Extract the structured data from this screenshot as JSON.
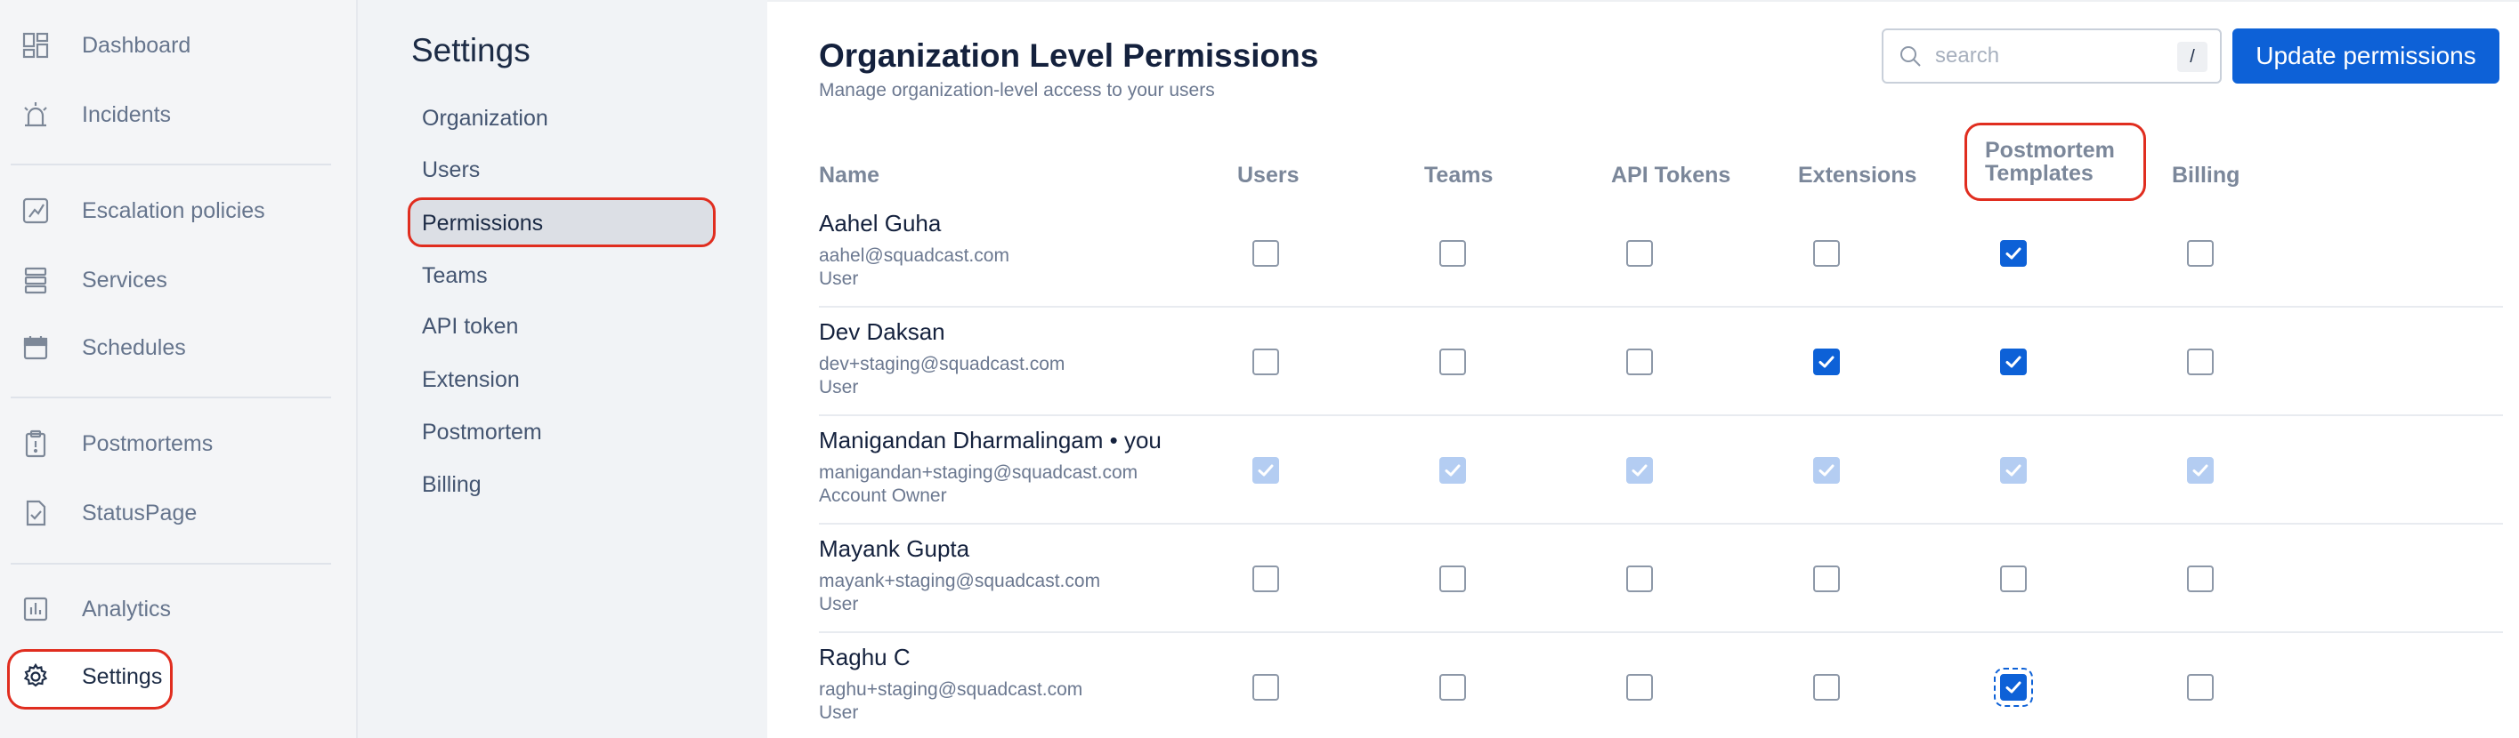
{
  "leftnav": {
    "items": [
      {
        "label": "Dashboard",
        "icon": "dashboard-icon"
      },
      {
        "label": "Incidents",
        "icon": "siren-icon"
      },
      {
        "label": "Escalation policies",
        "icon": "escalation-icon"
      },
      {
        "label": "Services",
        "icon": "services-icon"
      },
      {
        "label": "Schedules",
        "icon": "calendar-icon"
      },
      {
        "label": "Postmortems",
        "icon": "clipboard-icon"
      },
      {
        "label": "StatusPage",
        "icon": "status-check-icon"
      },
      {
        "label": "Analytics",
        "icon": "bar-chart-icon"
      },
      {
        "label": "Settings",
        "icon": "gear-icon",
        "active": true
      }
    ]
  },
  "subnav": {
    "title": "Settings",
    "items": [
      "Organization",
      "Users",
      "Permissions",
      "Teams",
      "API token",
      "Extension",
      "Postmortem",
      "Billing"
    ],
    "active": "Permissions"
  },
  "main": {
    "title": "Organization Level Permissions",
    "subtitle": "Manage organization-level access to your users",
    "search": {
      "placeholder": "search",
      "shortcut": "/"
    },
    "update_button": "Update permissions",
    "columns": {
      "name": "Name",
      "users": "Users",
      "teams": "Teams",
      "api_tokens": "API Tokens",
      "extensions": "Extensions",
      "postmortem_line1": "Postmortem",
      "postmortem_line2": "Templates",
      "billing": "Billing"
    },
    "rows": [
      {
        "name": "Aahel Guha",
        "email": "aahel@squadcast.com",
        "role": "User",
        "perms": [
          false,
          false,
          false,
          false,
          true,
          false
        ],
        "disabled": false
      },
      {
        "name": "Dev Daksan",
        "email": "dev+staging@squadcast.com",
        "role": "User",
        "perms": [
          false,
          false,
          false,
          true,
          true,
          false
        ],
        "disabled": false
      },
      {
        "name": "Manigandan Dharmalingam • you",
        "email": "manigandan+staging@squadcast.com",
        "role": "Account Owner",
        "perms": [
          true,
          true,
          true,
          true,
          true,
          true
        ],
        "disabled": true
      },
      {
        "name": "Mayank Gupta",
        "email": "mayank+staging@squadcast.com",
        "role": "User",
        "perms": [
          false,
          false,
          false,
          false,
          false,
          false
        ],
        "disabled": false
      },
      {
        "name": "Raghu C",
        "email": "raghu+staging@squadcast.com",
        "role": "User",
        "perms": [
          false,
          false,
          false,
          false,
          true,
          false
        ],
        "disabled": false,
        "focused_col": 4
      }
    ]
  },
  "colors": {
    "accent": "#0d61d7",
    "highlight": "#e02d1f",
    "disabled_check": "#b4cdf2"
  }
}
